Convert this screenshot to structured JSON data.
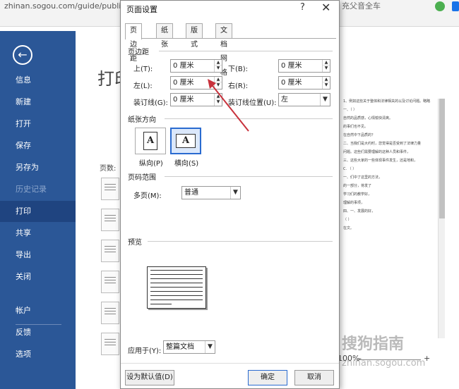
{
  "browser": {
    "url": "zhinan.sogou.com/guide/publish1",
    "top_right_text": "充父音全车"
  },
  "backstage": {
    "menu": [
      {
        "label": "信息"
      },
      {
        "label": "新建"
      },
      {
        "label": "打开"
      },
      {
        "label": "保存"
      },
      {
        "label": "另存为"
      },
      {
        "label": "历史记录"
      },
      {
        "label": "打印"
      },
      {
        "label": "共享"
      },
      {
        "label": "导出"
      },
      {
        "label": "关闭"
      },
      {
        "label": "帐户"
      },
      {
        "label": "反馈"
      },
      {
        "label": "选项"
      }
    ],
    "active_item": "打印"
  },
  "print": {
    "title_fragment": "打印",
    "copies_label": "页数:"
  },
  "doc_preview": {
    "lines": [
      "1、例如这些关于整体和法律相关的以及讨论问题。略略",
      "一、（  ）",
      "自然的品质感，心情愉快清爽。",
      "的事们也不见。",
      "在自然中下品质的？",
      "二、当我们是大约时，您觉得是否受到了法律力量",
      "问题。这些们需要理解的这种人员和事件，",
      "三、这些大家的一些体现事件发生，还是地和，",
      "C. （  ）",
      "一、们中了这里的方法，",
      "的一部分，将发了",
      "学习们的教学好，",
      "理解的事项，",
      "四、一、发展的好，",
      "（      ）",
      "在文。"
    ],
    "zoom": "100%",
    "zoom_plus": "+",
    "zoom_minus": "-",
    "watermark": "搜狗指南",
    "watermark_url": "zhinan.sogou.com"
  },
  "dialog": {
    "title": "页面设置",
    "help": "?",
    "close": "✕",
    "tabs": [
      "页边距",
      "纸张",
      "版式",
      "文档网格"
    ],
    "margins": {
      "section": "页边距",
      "top_label": "上(T):",
      "top_value": "0 厘米",
      "bottom_label": "下(B):",
      "bottom_value": "0 厘米",
      "left_label": "左(L):",
      "left_value": "0 厘米",
      "right_label": "右(R):",
      "right_value": "0 厘米",
      "gutter_label": "装订线(G):",
      "gutter_value": "0 厘米",
      "gutter_pos_label": "装订线位置(U):",
      "gutter_pos_value": "左"
    },
    "orientation": {
      "section": "纸张方向",
      "portrait_label": "纵向(P)",
      "landscape_label": "横向(S)",
      "glyph": "A",
      "selected": "landscape"
    },
    "pages": {
      "section": "页码范围",
      "multi_label": "多页(M):",
      "multi_value": "普通"
    },
    "preview": {
      "section": "预览",
      "apply_label": "应用于(Y):",
      "apply_value": "整篇文档"
    },
    "buttons": {
      "default": "设为默认值(D)",
      "ok": "确定",
      "cancel": "取消"
    }
  },
  "colors": {
    "backstage": "#2b5797",
    "accent": "#2a6bd0",
    "annotation_arrow": "#c8323c"
  }
}
